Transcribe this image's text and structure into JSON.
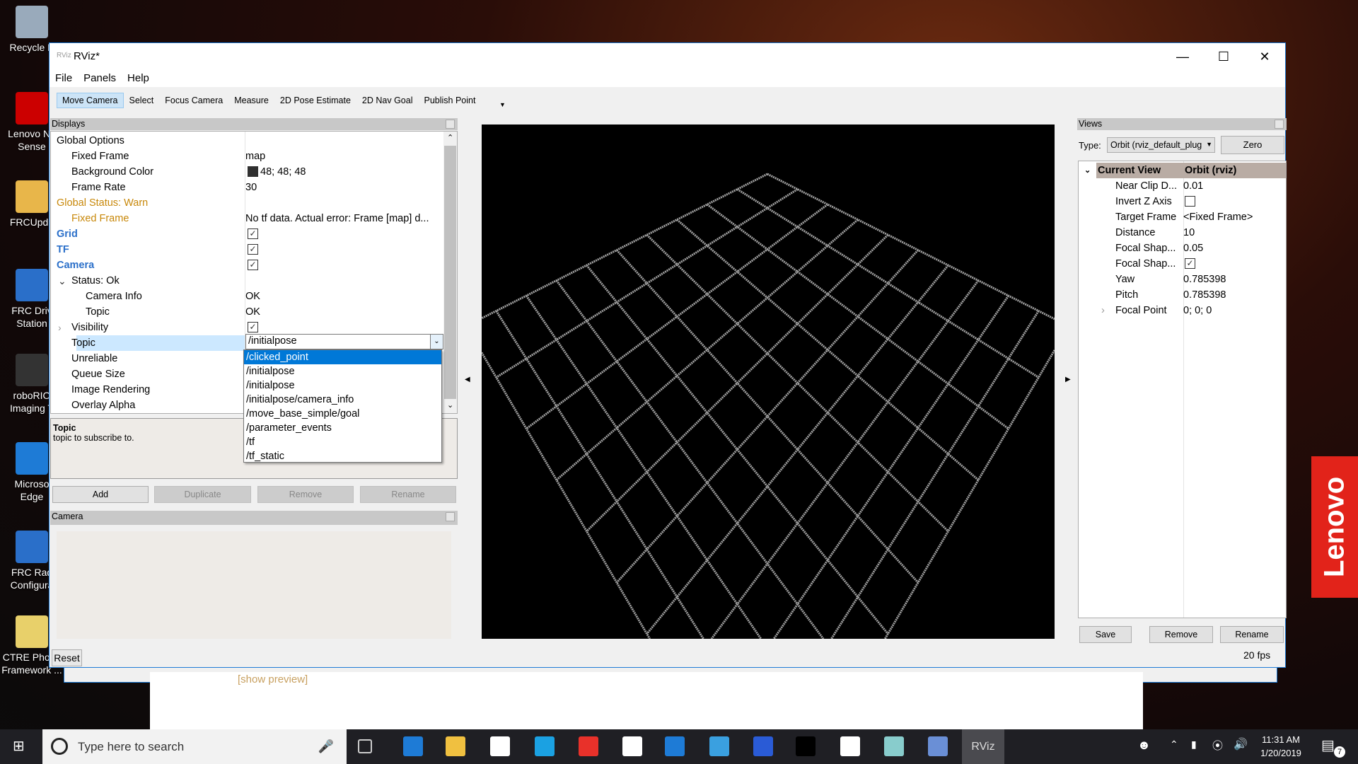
{
  "desktop": {
    "icons": [
      "Recycle B",
      "Lenovo Ne\nSense",
      "FRCUpda",
      "FRC Driv\nStation",
      "roboRIO\nImaging T",
      "Microso\nEdge",
      "FRC Rad\nConfigura",
      "CTRE Phoen\nFramework ..."
    ]
  },
  "behind": {
    "link": "[show preview]"
  },
  "brand": "Lenovo",
  "window": {
    "title": "RViz*",
    "menu": [
      "File",
      "Panels",
      "Help"
    ],
    "toolbar": [
      "Move Camera",
      "Select",
      "Focus Camera",
      "Measure",
      "2D Pose Estimate",
      "2D Nav Goal",
      "Publish Point"
    ],
    "displays": {
      "title": "Displays",
      "rows": [
        {
          "label": "Global Options",
          "value": "",
          "indent": 0,
          "color": "#000"
        },
        {
          "label": "Fixed Frame",
          "value": "map",
          "indent": 1,
          "color": "#000"
        },
        {
          "label": "Background Color",
          "value": "48; 48; 48",
          "indent": 1,
          "color": "#000",
          "swatch": "#303030"
        },
        {
          "label": "Frame Rate",
          "value": "30",
          "indent": 1,
          "color": "#000"
        },
        {
          "label": "Global Status: Warn",
          "value": "",
          "indent": 0,
          "color": "#c8880a"
        },
        {
          "label": "Fixed Frame",
          "value": "No tf data.  Actual error: Frame [map] d...",
          "indent": 1,
          "color": "#c8880a"
        },
        {
          "label": "Grid",
          "value": "",
          "indent": 0,
          "color": "#2a6fc9",
          "bold": true,
          "check": true
        },
        {
          "label": "TF",
          "value": "",
          "indent": 0,
          "color": "#2a6fc9",
          "bold": true,
          "check": true
        },
        {
          "label": "Camera",
          "value": "",
          "indent": 0,
          "color": "#2a6fc9",
          "bold": true,
          "check": true
        },
        {
          "label": "Status: Ok",
          "value": "",
          "indent": 1,
          "color": "#000",
          "expander": "open"
        },
        {
          "label": "Camera Info",
          "value": "OK",
          "indent": 2,
          "color": "#000"
        },
        {
          "label": "Topic",
          "value": "OK",
          "indent": 2,
          "color": "#000"
        },
        {
          "label": "Visibility",
          "value": "",
          "indent": 1,
          "color": "#000",
          "expander": "closed",
          "check": true
        },
        {
          "label": "Topic",
          "value": "",
          "indent": 1,
          "color": "#000",
          "selected": true
        },
        {
          "label": "Unreliable",
          "value": "",
          "indent": 1,
          "color": "#000"
        },
        {
          "label": "Queue Size",
          "value": "",
          "indent": 1,
          "color": "#000"
        },
        {
          "label": "Image Rendering",
          "value": "",
          "indent": 1,
          "color": "#000"
        },
        {
          "label": "Overlay Alpha",
          "value": "",
          "indent": 1,
          "color": "#000"
        }
      ],
      "topic_combo": {
        "value": "/initialpose",
        "options": [
          "/clicked_point",
          "/initialpose",
          "/initialpose",
          "/initialpose/camera_info",
          "/move_base_simple/goal",
          "/parameter_events",
          "/tf",
          "/tf_static"
        ],
        "highlighted": 0
      },
      "description": {
        "title": "Topic",
        "text": "topic to subscribe to."
      },
      "buttons": {
        "add": "Add",
        "duplicate": "Duplicate",
        "remove": "Remove",
        "rename": "Rename"
      }
    },
    "camera_panel": {
      "title": "Camera",
      "reset": "Reset"
    },
    "views": {
      "title": "Views",
      "type_label": "Type:",
      "type_value": "Orbit (rviz_default_pluɡ",
      "zero": "Zero",
      "header": {
        "label": "Current View",
        "value": "Orbit (rviz)"
      },
      "rows": [
        {
          "label": "Near Clip D...",
          "value": "0.01"
        },
        {
          "label": "Invert Z Axis",
          "value": "",
          "check": false
        },
        {
          "label": "Target Frame",
          "value": "<Fixed Frame>"
        },
        {
          "label": "Distance",
          "value": "10"
        },
        {
          "label": "Focal Shap...",
          "value": "0.05"
        },
        {
          "label": "Focal Shap...",
          "value": "",
          "check": true
        },
        {
          "label": "Yaw",
          "value": "0.785398"
        },
        {
          "label": "Pitch",
          "value": "0.785398"
        },
        {
          "label": "Focal Point",
          "value": "0; 0; 0",
          "expander": "closed"
        }
      ],
      "buttons": {
        "save": "Save",
        "remove": "Remove",
        "rename": "Rename"
      }
    },
    "fps": "20 fps"
  },
  "taskbar": {
    "search_placeholder": "Type here to search",
    "active_app": "RViz",
    "time": "11:31 AM",
    "date": "1/20/2019",
    "notification_count": "7"
  },
  "colors": {
    "accent": "#0078d7",
    "warn": "#c8880a",
    "display_name": "#2a6fc9",
    "grid": "#a0a0a0"
  }
}
